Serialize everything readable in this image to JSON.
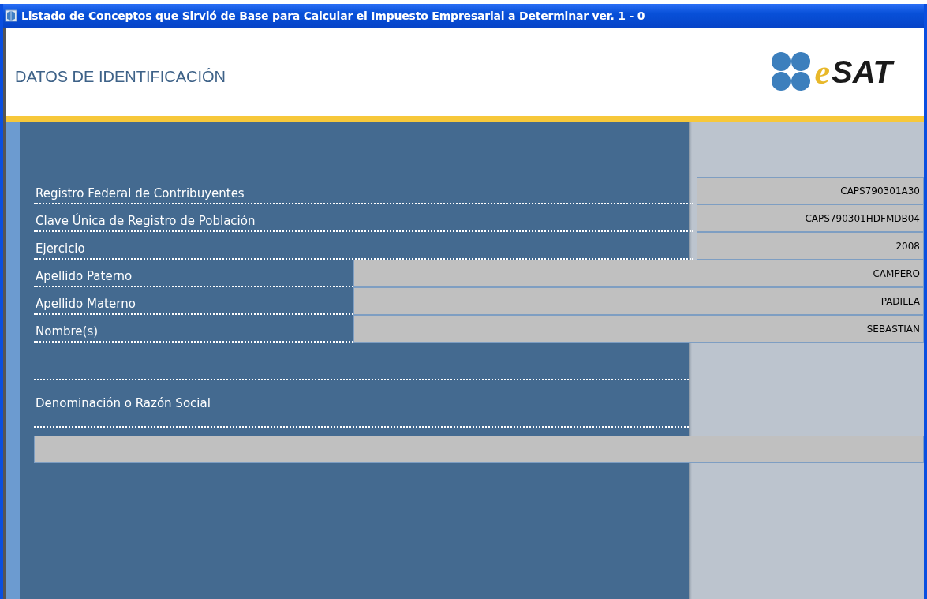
{
  "window": {
    "title": "Listado de Conceptos que Sirvió de Base para Calcular el Impuesto Empresarial a Determinar ver. 1 - 0"
  },
  "header": {
    "title": "DATOS DE IDENTIFICACIÓN",
    "logo_mark": "e",
    "logo": "SAT"
  },
  "fields": [
    {
      "kind": "short",
      "label": "Registro Federal de Contribuyentes",
      "value": "CAPS790301A30"
    },
    {
      "kind": "short",
      "label": "Clave Única de Registro de Población",
      "value": "CAPS790301HDFMDB04"
    },
    {
      "kind": "short",
      "label": "Ejercicio",
      "value": "2008"
    },
    {
      "kind": "long",
      "label": "Apellido Paterno",
      "value": "CAMPERO"
    },
    {
      "kind": "long",
      "label": "Apellido Materno",
      "value": "PADILLA"
    },
    {
      "kind": "long",
      "label": "Nombre(s)",
      "value": "SEBASTIAN"
    }
  ],
  "company": {
    "label": "Denominación o Razón Social"
  }
}
